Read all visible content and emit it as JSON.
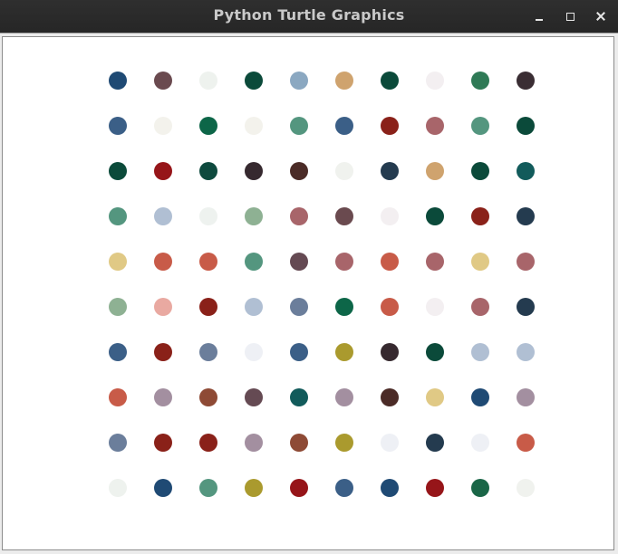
{
  "window": {
    "title": "Python Turtle Graphics"
  },
  "icons": {
    "minimize": "minimize-icon",
    "maximize": "maximize-icon",
    "close": "close-icon"
  },
  "dot_grid": {
    "rows": [
      [
        "#1f4a74",
        "#6a4a4f",
        "#eef2ee",
        "#0b4a3a",
        "#8ba8c1",
        "#cfa36e",
        "#0b4a3a",
        "#f3eff1",
        "#2f7a56",
        "#3a2d33"
      ],
      [
        "#3b5f87",
        "#f3f2ec",
        "#0d6648",
        "#f3f2ec",
        "#54967f",
        "#3b5f87",
        "#8a2119",
        "#a8656a",
        "#54967f",
        "#0b4a3a"
      ],
      [
        "#0b4a3a",
        "#961519",
        "#0e4a3e",
        "#36292f",
        "#4b2b27",
        "#f0f2ee",
        "#243b4f",
        "#cfa36e",
        "#0b4a3a",
        "#125b5b"
      ],
      [
        "#54967f",
        "#b0bfd3",
        "#eef2ef",
        "#8eb193",
        "#a8656a",
        "#6a4a4f",
        "#f3eff1",
        "#0b4a3a",
        "#8a2119",
        "#243b4f"
      ],
      [
        "#e0c985",
        "#c85b48",
        "#c85b48",
        "#54967f",
        "#654a53",
        "#a8656a",
        "#c85b48",
        "#a8656a",
        "#e0c985",
        "#a8656a"
      ],
      [
        "#8eb193",
        "#e9a9a1",
        "#8a2119",
        "#b0bfd3",
        "#6b7e9b",
        "#0d6648",
        "#c85b48",
        "#f3eff1",
        "#a8656a",
        "#243b4f"
      ],
      [
        "#3b5f87",
        "#8a2119",
        "#6b7e9b",
        "#eef0f5",
        "#3b5f87",
        "#aa9a2e",
        "#36292f",
        "#0b4a3a",
        "#b0bfd3",
        "#b0bfd3"
      ],
      [
        "#c85b48",
        "#a38fa0",
        "#8e4a35",
        "#654a53",
        "#125b5b",
        "#a38fa0",
        "#4b2b27",
        "#e0c985",
        "#1f4a74",
        "#a38fa0"
      ],
      [
        "#6b7e9b",
        "#8a2119",
        "#8a2119",
        "#a38fa0",
        "#8e4a35",
        "#aa9a2e",
        "#eef0f5",
        "#243b4f",
        "#eef0f5",
        "#c85b48"
      ],
      [
        "#eef2ee",
        "#1f4a74",
        "#54967f",
        "#aa9a2e",
        "#961519",
        "#3b5f87",
        "#1f4a74",
        "#961519",
        "#1a6647",
        "#f0f2ee"
      ]
    ]
  }
}
